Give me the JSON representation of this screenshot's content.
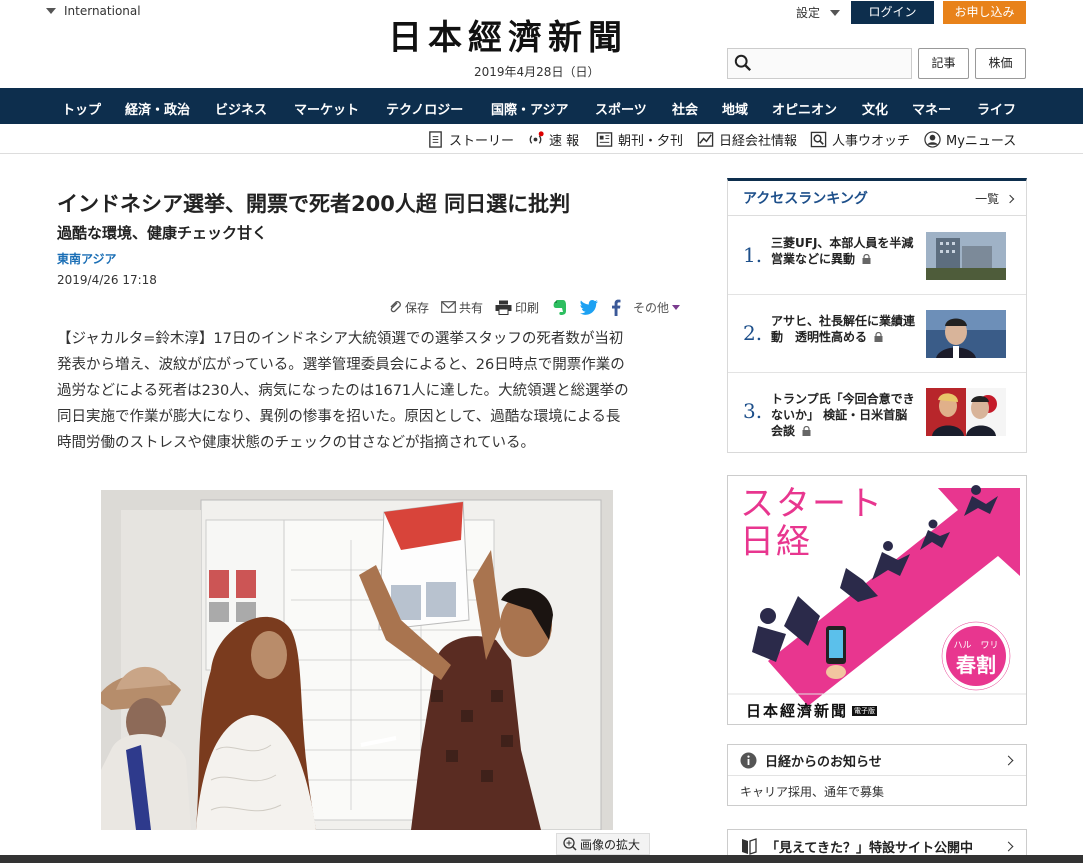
{
  "header": {
    "edition": "International",
    "logo": "日本經濟新聞",
    "date": "2019年4月28日（日）",
    "settings": "設定",
    "login": "ログイン",
    "subscribe": "お申し込み",
    "search_placeholder": "",
    "articles_button": "記事",
    "stocks_button": "株価"
  },
  "nav": {
    "items": [
      "トップ",
      "経済・政治",
      "ビジネス",
      "マーケット",
      "テクノロジー",
      "国際・アジア",
      "スポーツ",
      "社会",
      "地域",
      "オピニオン",
      "文化",
      "マネー",
      "ライフ"
    ]
  },
  "subnav": {
    "story": "ストーリー",
    "breaking": "速 報",
    "papers": "朝刊・夕刊",
    "company_info": "日経会社情報",
    "personnel": "人事ウオッチ",
    "my_news": "Myニュース"
  },
  "article": {
    "headline": "インドネシア選挙、開票で死者200人超 同日選に批判",
    "subheadline": "過酷な環境、健康チェック甘く",
    "category": "東南アジア",
    "datetime": "2019/4/26 17:18",
    "share": {
      "save": "保存",
      "share": "共有",
      "print": "印刷",
      "other": "その他"
    },
    "body_lines": [
      "【ジャカルタ=鈴木淳】17日のインドネシア大統領選での選挙スタッフの死者数が当初",
      "発表から増え、波紋が広がっている。選挙管理委員会によると、26日時点で開票作業の",
      "過労などによる死者は230人、病気になったのは1671人に達した。大統領選と総選挙の",
      "同日実施で作業が膨大になり、異例の惨事を招いた。原因として、過酷な環境による長",
      "時間労働のストレスや健康状態のチェックの甘さなどが指摘されている。"
    ],
    "zoom_label": "画像の拡大"
  },
  "ranking": {
    "title": "アクセスランキング",
    "more": "一覧",
    "items": [
      {
        "rank": "1.",
        "text": "三菱UFJ、本部人員を半減 営業などに異動"
      },
      {
        "rank": "2.",
        "text": "アサヒ、社長解任に業績連動　透明性高める"
      },
      {
        "rank": "3.",
        "text": "トランプ氏「今回合意できないか」 検証・日米首脳会談"
      }
    ]
  },
  "ad": {
    "headline_1": "スタート",
    "headline_2": "日経",
    "badge_small": "ハル　ワリ",
    "badge_main": "春割",
    "logo": "日本經濟新聞",
    "logo_tag": "電子版"
  },
  "notice": {
    "title": "日経からのお知らせ",
    "body": "キャリア採用、通年で募集"
  },
  "promo": {
    "text": "「見えてきた？」特設サイト公開中"
  },
  "colors": {
    "navy": "#0d2e4d",
    "orange": "#e8821a",
    "link_blue": "#1a6eb5",
    "ad_pink": "#e8368f"
  }
}
